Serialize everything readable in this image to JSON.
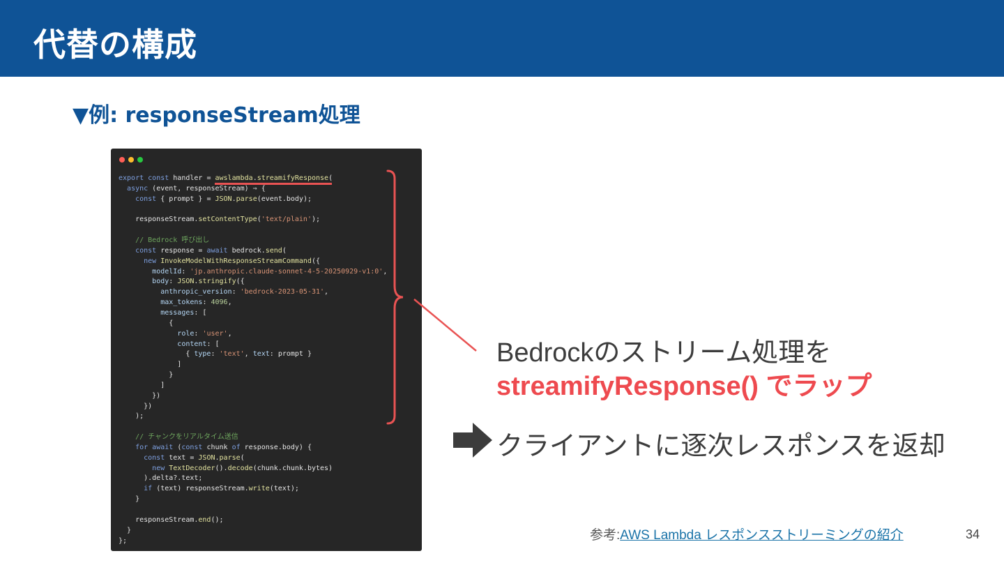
{
  "header": {
    "title": "代替の構成"
  },
  "subtitle": "▼例:  responseStream処理",
  "code_window": {
    "dot_colors": [
      "#ff5f57",
      "#febc2e",
      "#28c840"
    ],
    "lines": [
      [
        [
          "kw",
          "export "
        ],
        [
          "kw",
          "const "
        ],
        [
          "tx",
          "handler = "
        ],
        [
          "fn",
          "awslambda"
        ],
        [
          "tx",
          "."
        ],
        [
          "fn",
          "streamifyResponse"
        ],
        [
          "tx",
          "("
        ]
      ],
      [
        [
          "tx",
          "  "
        ],
        [
          "kw",
          "async "
        ],
        [
          "tx",
          "(event, responseStream) ⇒ {"
        ]
      ],
      [
        [
          "tx",
          "    "
        ],
        [
          "kw",
          "const "
        ],
        [
          "tx",
          "{ prompt } = "
        ],
        [
          "fn",
          "JSON"
        ],
        [
          "tx",
          "."
        ],
        [
          "fn",
          "parse"
        ],
        [
          "tx",
          "(event.body);"
        ]
      ],
      [],
      [
        [
          "tx",
          "    responseStream."
        ],
        [
          "fn",
          "setContentType"
        ],
        [
          "tx",
          "("
        ],
        [
          "str",
          "'text/plain'"
        ],
        [
          "tx",
          ");"
        ]
      ],
      [],
      [
        [
          "cm",
          "    // Bedrock 呼び出し"
        ]
      ],
      [
        [
          "tx",
          "    "
        ],
        [
          "kw",
          "const "
        ],
        [
          "tx",
          "response = "
        ],
        [
          "kw",
          "await "
        ],
        [
          "tx",
          "bedrock."
        ],
        [
          "fn",
          "send"
        ],
        [
          "tx",
          "("
        ]
      ],
      [
        [
          "tx",
          "      "
        ],
        [
          "kw",
          "new "
        ],
        [
          "fn",
          "InvokeModelWithResponseStreamCommand"
        ],
        [
          "tx",
          "({"
        ]
      ],
      [
        [
          "tx",
          "        "
        ],
        [
          "prop",
          "modelId"
        ],
        [
          "tx",
          ": "
        ],
        [
          "str",
          "'jp.anthropic.claude-sonnet-4-5-20250929-v1:0'"
        ],
        [
          "tx",
          ","
        ]
      ],
      [
        [
          "tx",
          "        "
        ],
        [
          "prop",
          "body"
        ],
        [
          "tx",
          ": "
        ],
        [
          "fn",
          "JSON"
        ],
        [
          "tx",
          "."
        ],
        [
          "fn",
          "stringify"
        ],
        [
          "tx",
          "({"
        ]
      ],
      [
        [
          "tx",
          "          "
        ],
        [
          "prop",
          "anthropic_version"
        ],
        [
          "tx",
          ": "
        ],
        [
          "str",
          "'bedrock-2023-05-31'"
        ],
        [
          "tx",
          ","
        ]
      ],
      [
        [
          "tx",
          "          "
        ],
        [
          "prop",
          "max_tokens"
        ],
        [
          "tx",
          ": "
        ],
        [
          "num",
          "4096"
        ],
        [
          "tx",
          ","
        ]
      ],
      [
        [
          "tx",
          "          "
        ],
        [
          "prop",
          "messages"
        ],
        [
          "tx",
          ": ["
        ]
      ],
      [
        [
          "tx",
          "            {"
        ]
      ],
      [
        [
          "tx",
          "              "
        ],
        [
          "prop",
          "role"
        ],
        [
          "tx",
          ": "
        ],
        [
          "str",
          "'user'"
        ],
        [
          "tx",
          ","
        ]
      ],
      [
        [
          "tx",
          "              "
        ],
        [
          "prop",
          "content"
        ],
        [
          "tx",
          ": ["
        ]
      ],
      [
        [
          "tx",
          "                { "
        ],
        [
          "prop",
          "type"
        ],
        [
          "tx",
          ": "
        ],
        [
          "str",
          "'text'"
        ],
        [
          "tx",
          ", "
        ],
        [
          "prop",
          "text"
        ],
        [
          "tx",
          ": prompt }"
        ]
      ],
      [
        [
          "tx",
          "              ]"
        ]
      ],
      [
        [
          "tx",
          "            }"
        ]
      ],
      [
        [
          "tx",
          "          ]"
        ]
      ],
      [
        [
          "tx",
          "        })"
        ]
      ],
      [
        [
          "tx",
          "      })"
        ]
      ],
      [
        [
          "tx",
          "    );"
        ]
      ],
      [],
      [
        [
          "cm",
          "    // チャンクをリアルタイム送信"
        ]
      ],
      [
        [
          "tx",
          "    "
        ],
        [
          "kw",
          "for await "
        ],
        [
          "tx",
          "("
        ],
        [
          "kw",
          "const "
        ],
        [
          "tx",
          "chunk "
        ],
        [
          "kw",
          "of "
        ],
        [
          "tx",
          "response.body) {"
        ]
      ],
      [
        [
          "tx",
          "      "
        ],
        [
          "kw",
          "const "
        ],
        [
          "tx",
          "text = "
        ],
        [
          "fn",
          "JSON"
        ],
        [
          "tx",
          "."
        ],
        [
          "fn",
          "parse"
        ],
        [
          "tx",
          "("
        ]
      ],
      [
        [
          "tx",
          "        "
        ],
        [
          "kw",
          "new "
        ],
        [
          "fn",
          "TextDecoder"
        ],
        [
          "tx",
          "()."
        ],
        [
          "fn",
          "decode"
        ],
        [
          "tx",
          "(chunk.chunk.bytes)"
        ]
      ],
      [
        [
          "tx",
          "      ).delta?.text;"
        ]
      ],
      [
        [
          "tx",
          "      "
        ],
        [
          "kw",
          "if "
        ],
        [
          "tx",
          "(text) responseStream."
        ],
        [
          "fn",
          "write"
        ],
        [
          "tx",
          "(text);"
        ]
      ],
      [
        [
          "tx",
          "    }"
        ]
      ],
      [],
      [
        [
          "tx",
          "    responseStream."
        ],
        [
          "fn",
          "end"
        ],
        [
          "tx",
          "();"
        ]
      ],
      [
        [
          "tx",
          "  }"
        ]
      ],
      [
        [
          "tx",
          "};"
        ]
      ]
    ]
  },
  "callout": {
    "line1": "Bedrockのストリーム処理を",
    "line2": "streamifyResponse() でラップ",
    "line3": "クライアントに逐次レスポンスを返却",
    "accent_color": "#ee4a4f",
    "arrow_icon": "right-arrow-icon"
  },
  "reference": {
    "prefix": "参考:",
    "link_text": "AWS Lambda レスポンスストリーミングの紹介"
  },
  "page_number": "34"
}
